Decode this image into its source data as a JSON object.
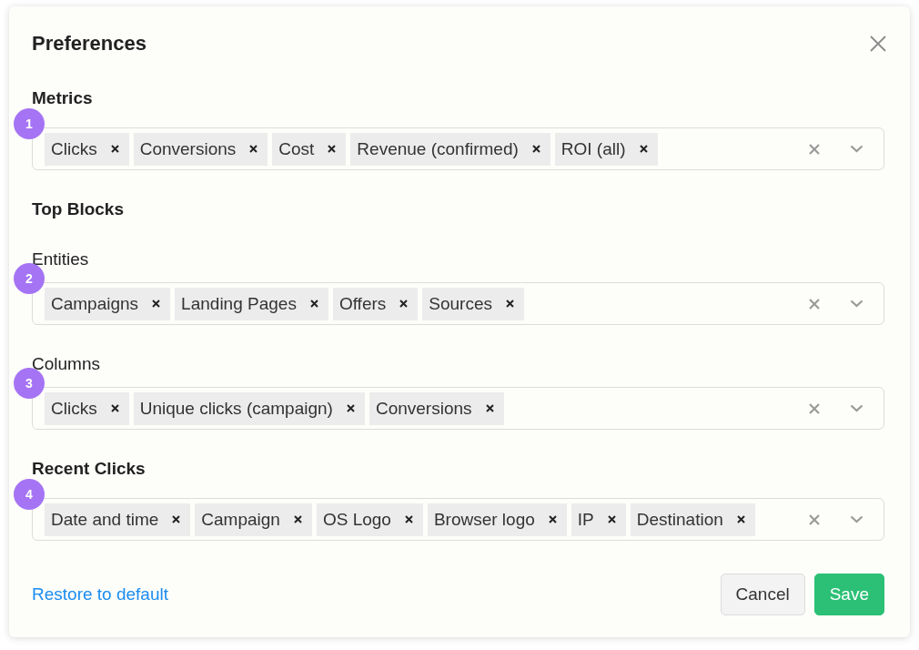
{
  "dialog": {
    "title": "Preferences"
  },
  "sections": [
    {
      "label": "Metrics",
      "kind": "heading",
      "badge": "1",
      "tags": [
        "Clicks",
        "Conversions",
        "Cost",
        "Revenue (confirmed)",
        "ROI (all)"
      ]
    },
    {
      "label": "Top Blocks",
      "kind": "heading"
    },
    {
      "label": "Entities",
      "kind": "sublabel",
      "badge": "2",
      "tags": [
        "Campaigns",
        "Landing Pages",
        "Offers",
        "Sources"
      ]
    },
    {
      "label": "Columns",
      "kind": "sublabel",
      "badge": "3",
      "tags": [
        "Clicks",
        "Unique clicks (campaign)",
        "Conversions"
      ]
    },
    {
      "label": "Recent Clicks",
      "kind": "heading",
      "badge": "4",
      "tags": [
        "Date and time",
        "Campaign",
        "OS Logo",
        "Browser logo",
        "IP",
        "Destination"
      ]
    }
  ],
  "footer": {
    "link": "Restore to default",
    "buttons": [
      {
        "label": "Cancel",
        "kind": "secondary"
      },
      {
        "label": "Save",
        "kind": "primary"
      }
    ]
  }
}
